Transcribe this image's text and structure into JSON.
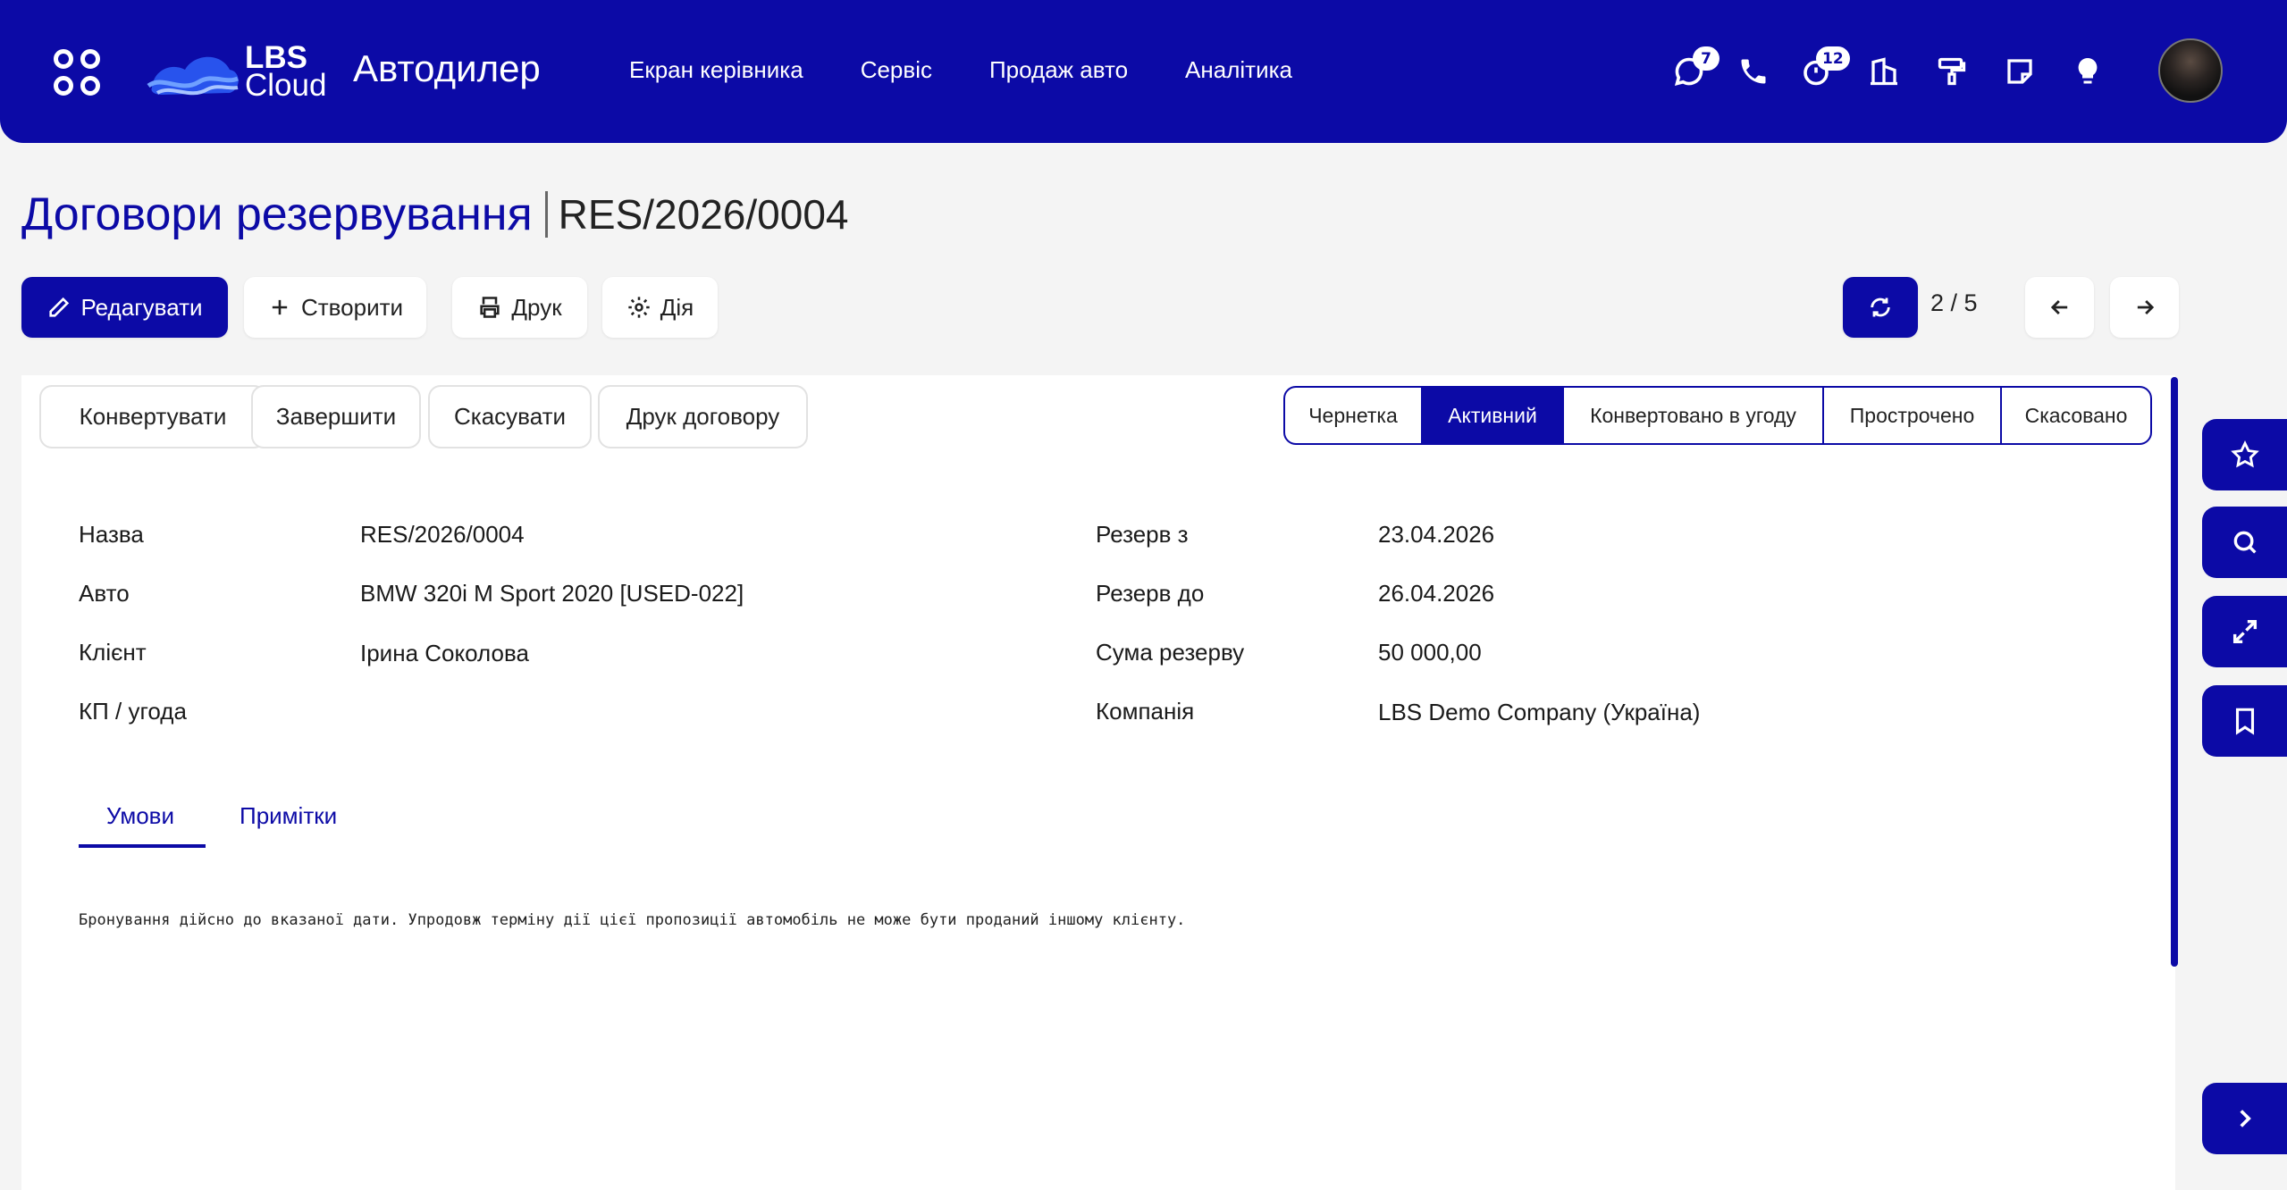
{
  "header": {
    "logo_line1": "LBS",
    "logo_line2": "Cloud",
    "app_name": "Автодилер",
    "nav": [
      "Екран керівника",
      "Сервіс",
      "Продаж авто",
      "Аналітика"
    ],
    "icons": [
      {
        "name": "chat-icon",
        "badge": "7"
      },
      {
        "name": "phone-icon",
        "badge": null
      },
      {
        "name": "timer-icon",
        "badge": "12"
      },
      {
        "name": "building-icon",
        "badge": null
      },
      {
        "name": "paint-roller-icon",
        "badge": null
      },
      {
        "name": "note-icon",
        "badge": null
      },
      {
        "name": "lightbulb-icon",
        "badge": null
      }
    ]
  },
  "breadcrumb": {
    "section": "Договори резервування",
    "record": "RES/2026/0004"
  },
  "toolbar": {
    "edit": "Редагувати",
    "create": "Створити",
    "print": "Друк",
    "action": "Дія",
    "pager": "2 / 5"
  },
  "actions": {
    "convert": "Конвертувати",
    "complete": "Завершити",
    "cancel": "Скасувати",
    "print_contract": "Друк договору"
  },
  "statusbar": {
    "items": [
      "Чернетка",
      "Активний",
      "Конвертовано в угоду",
      "Прострочено",
      "Скасовано"
    ],
    "active": "Активний"
  },
  "form": {
    "left": [
      {
        "label": "Назва",
        "value": "RES/2026/0004"
      },
      {
        "label": "Авто",
        "value": "BMW 320i M Sport 2020 [USED-022]"
      },
      {
        "label": "Клієнт",
        "value": "Ірина Соколова"
      },
      {
        "label": "КП / угода",
        "value": ""
      }
    ],
    "right": [
      {
        "label": "Резерв з",
        "value": "23.04.2026"
      },
      {
        "label": "Резерв до",
        "value": "26.04.2026"
      },
      {
        "label": "Сума резерву",
        "value": "50 000,00"
      },
      {
        "label": "Компанія",
        "value": "LBS Demo Company (Україна)"
      }
    ]
  },
  "tabs": {
    "terms": "Умови",
    "notes": "Примітки",
    "active": "Умови"
  },
  "terms_text": "Бронування дійсно до вказаної дати. Упродовж терміну дії цієї пропозиції автомобіль не може бути проданий іншому клієнту.",
  "colors": {
    "primary": "#0c0aa6",
    "background": "#f4f4f4"
  }
}
